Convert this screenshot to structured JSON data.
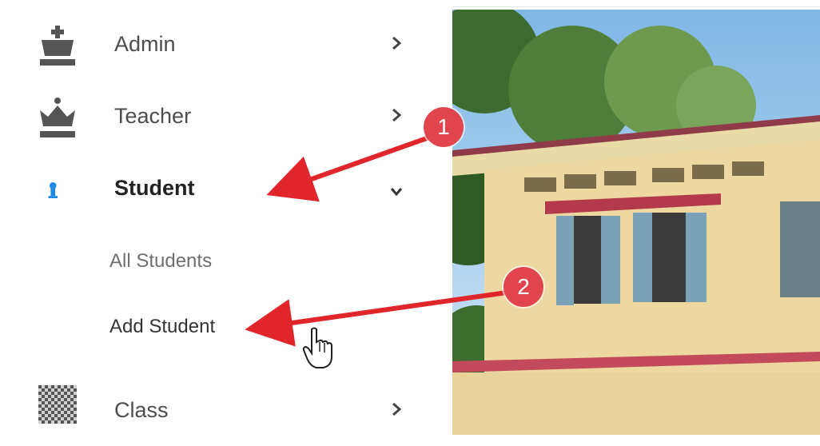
{
  "sidebar": {
    "items": [
      {
        "label": "Admin",
        "icon": "chess-king-icon",
        "chevron": "chevron-right-icon"
      },
      {
        "label": "Teacher",
        "icon": "chess-queen-icon",
        "chevron": "chevron-right-icon"
      },
      {
        "label": "Student",
        "icon": "chess-pawn-icon",
        "chevron": "chevron-down-icon",
        "active": true
      },
      {
        "label": "Class",
        "icon": "chess-board-icon",
        "chevron": "chevron-right-icon"
      }
    ],
    "student_submenu": [
      {
        "label": "All Students"
      },
      {
        "label": "Add Student"
      }
    ]
  },
  "annotations": {
    "callout_1": "1",
    "callout_2": "2"
  },
  "colors": {
    "callout": "#e0454e",
    "arrow": "#e0262b",
    "active_icon": "#1e88e5",
    "icon": "#555555"
  },
  "photo": {
    "description_icon": "school-building-photo"
  }
}
